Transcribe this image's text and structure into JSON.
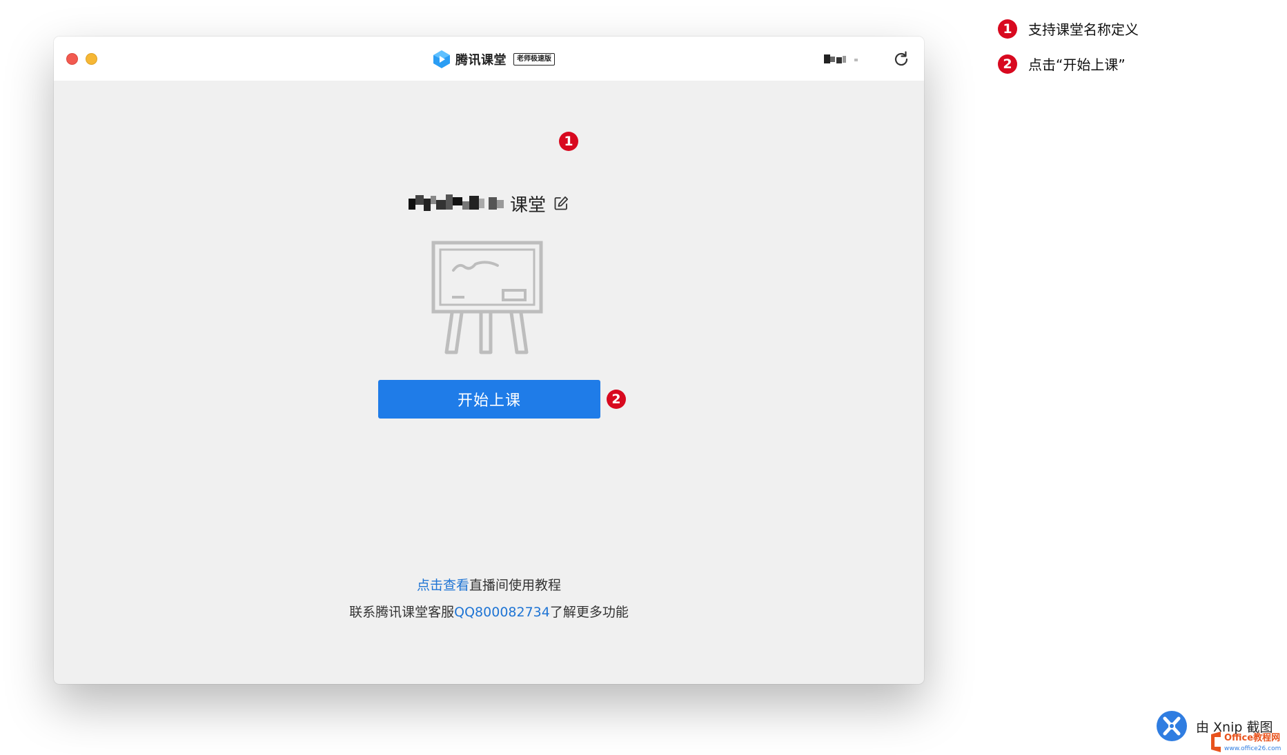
{
  "window": {
    "brand_name": "腾讯课堂",
    "brand_badge": "老师极速版"
  },
  "course": {
    "title_suffix": "课堂"
  },
  "actions": {
    "start_class": "开始上课"
  },
  "help": {
    "line1_link": "点击查看",
    "line1_text": "直播间使用教程",
    "line2_prefix": "联系腾讯课堂客服",
    "line2_link": "QQ800082734",
    "line2_suffix": "了解更多功能"
  },
  "markers": {
    "one": "1",
    "two": "2"
  },
  "legend": [
    {
      "number": "1",
      "text": "支持课堂名称定义"
    },
    {
      "number": "2",
      "text": "点击“开始上课”"
    }
  ],
  "watermark": {
    "xnip": "由 Xnip 截图",
    "office_line1": "Office教程网",
    "office_line2": "www.office26.com"
  },
  "icons": {
    "refresh": "refresh-icon",
    "edit": "edit-icon",
    "logo": "tencent-classroom-logo",
    "board": "whiteboard-easel-icon"
  },
  "colors": {
    "primary_button": "#1f7ce8",
    "link": "#1e74d4",
    "marker": "#d8091f"
  }
}
